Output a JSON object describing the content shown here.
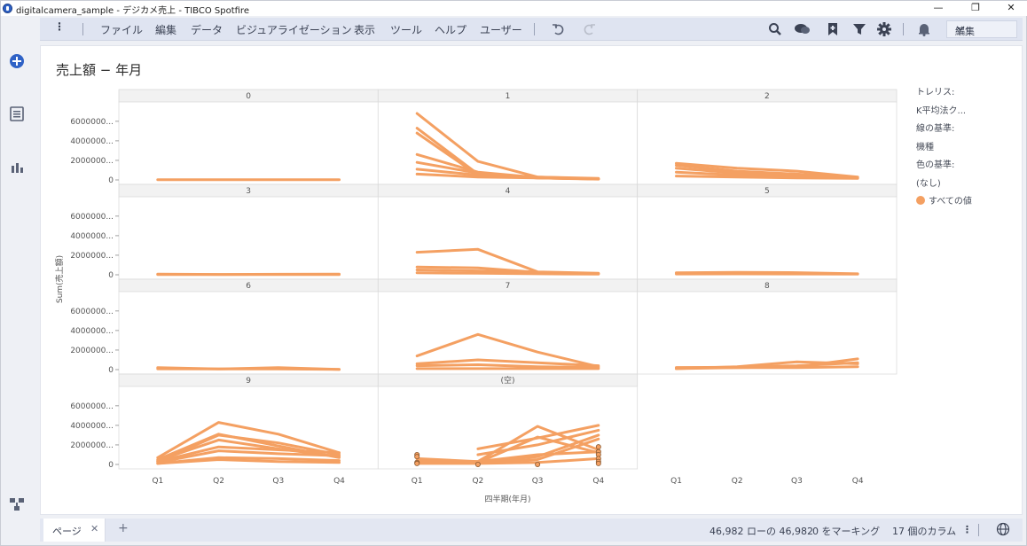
{
  "window": {
    "title": "digitalcamera_sample - デジカメ売上 - TIBCO Spotfire",
    "minimize": "—",
    "restore": "❐",
    "close": "✕"
  },
  "menu": {
    "items": [
      "ファイル",
      "編集",
      "データ",
      "ビジュアライゼーション",
      "表示",
      "ツール",
      "ヘルプ",
      "ユーザー"
    ],
    "mode": "編集"
  },
  "colors": {
    "line": "#f4a062",
    "accent": "#2f62c6",
    "panel_header": "#f2f2f2",
    "grid": "#e6e6e6"
  },
  "chart_data": {
    "type": "line",
    "title": "売上額 − 年月",
    "ylabel": "Sum(売上額)",
    "xlabel": "四半期(年月)",
    "x": [
      "Q1",
      "Q2",
      "Q3",
      "Q4"
    ],
    "y_ticks": [
      "6000000...",
      "4000000...",
      "2000000...",
      "0"
    ],
    "y_values": [
      6000000,
      4000000,
      2000000,
      0
    ],
    "ylim": [
      0,
      7800000
    ],
    "grid": true,
    "legend_position": "right",
    "trellis": [
      {
        "panel": "0",
        "series": [
          [
            20000,
            20000,
            20000,
            20000
          ]
        ]
      },
      {
        "panel": "1",
        "series": [
          [
            6800000,
            1900000,
            300000,
            100000
          ],
          [
            5300000,
            600000,
            200000,
            100000
          ],
          [
            4800000,
            500000,
            200000,
            100000
          ],
          [
            2600000,
            800000,
            250000,
            100000
          ],
          [
            1800000,
            700000,
            250000,
            100000
          ],
          [
            1100000,
            500000,
            300000,
            150000
          ],
          [
            600000,
            300000,
            200000,
            80000
          ]
        ]
      },
      {
        "panel": "2",
        "series": [
          [
            1700000,
            1200000,
            900000,
            300000
          ],
          [
            1500000,
            900000,
            600000,
            250000
          ],
          [
            1200000,
            700000,
            400000,
            200000
          ],
          [
            800000,
            500000,
            300000,
            200000
          ],
          [
            400000,
            300000,
            200000,
            150000
          ]
        ]
      },
      {
        "panel": "3",
        "series": [
          [
            60000,
            40000,
            50000,
            60000
          ],
          [
            20000,
            20000,
            20000,
            20000
          ]
        ]
      },
      {
        "panel": "4",
        "series": [
          [
            2300000,
            2600000,
            300000,
            150000
          ],
          [
            800000,
            700000,
            250000,
            100000
          ],
          [
            500000,
            400000,
            200000,
            100000
          ],
          [
            200000,
            150000,
            100000,
            60000
          ]
        ]
      },
      {
        "panel": "5",
        "series": [
          [
            200000,
            250000,
            220000,
            100000
          ],
          [
            80000,
            90000,
            80000,
            60000
          ]
        ]
      },
      {
        "panel": "6",
        "series": [
          [
            200000,
            60000,
            200000,
            20000
          ],
          [
            80000,
            60000,
            60000,
            20000
          ]
        ]
      },
      {
        "panel": "7",
        "series": [
          [
            1400000,
            3600000,
            1800000,
            300000
          ],
          [
            600000,
            1000000,
            700000,
            400000
          ],
          [
            400000,
            500000,
            300000,
            200000
          ],
          [
            100000,
            100000,
            100000,
            100000
          ]
        ]
      },
      {
        "panel": "8",
        "series": [
          [
            100000,
            300000,
            800000,
            600000
          ],
          [
            200000,
            200000,
            300000,
            1100000
          ],
          [
            200000,
            250000,
            400000,
            700000
          ],
          [
            100000,
            200000,
            200000,
            300000
          ]
        ]
      },
      {
        "panel": "9",
        "series": [
          [
            700000,
            4300000,
            3100000,
            1200000
          ],
          [
            500000,
            3100000,
            1900000,
            700000
          ],
          [
            300000,
            3000000,
            2200000,
            1000000
          ],
          [
            400000,
            2500000,
            1600000,
            800000
          ],
          [
            300000,
            1800000,
            1500000,
            1200000
          ],
          [
            200000,
            1400000,
            1100000,
            900000
          ],
          [
            100000,
            700000,
            600000,
            400000
          ],
          [
            100000,
            500000,
            300000,
            200000
          ]
        ]
      },
      {
        "panel": "(空)",
        "series": [
          [
            400000,
            300000,
            3900000,
            1500000
          ],
          [
            300000,
            200000,
            2800000,
            1200000
          ],
          [
            null,
            1600000,
            2700000,
            4000000
          ],
          [
            null,
            1000000,
            2000000,
            3500000
          ],
          [
            200000,
            300000,
            800000,
            3000000
          ],
          [
            300000,
            200000,
            500000,
            2600000
          ],
          [
            600000,
            300000,
            1000000,
            1300000
          ],
          [
            100000,
            100000,
            200000,
            600000
          ]
        ],
        "markers": [
          [
            "Q1",
            1000000
          ],
          [
            "Q1",
            800000
          ],
          [
            "Q1",
            200000
          ],
          [
            "Q1",
            100000
          ],
          [
            "Q2",
            0
          ],
          [
            "Q3",
            0
          ],
          [
            "Q4",
            1800000
          ],
          [
            "Q4",
            1300000
          ],
          [
            "Q4",
            1000000
          ],
          [
            "Q4",
            600000
          ],
          [
            "Q4",
            300000
          ],
          [
            "Q4",
            100000
          ]
        ]
      }
    ]
  },
  "legend": {
    "trellis_label": "トレリス:",
    "trellis_value": "K平均法ク...",
    "line_label": "線の基準:",
    "line_value": "機種",
    "color_label": "色の基準:",
    "color_value": "(なし)",
    "item": "すべての値"
  },
  "status": {
    "page_tab": "ページ",
    "rows": "46,982 ローの 46,982",
    "marked": "0 をマーキング",
    "columns": "17 個のカラム"
  }
}
